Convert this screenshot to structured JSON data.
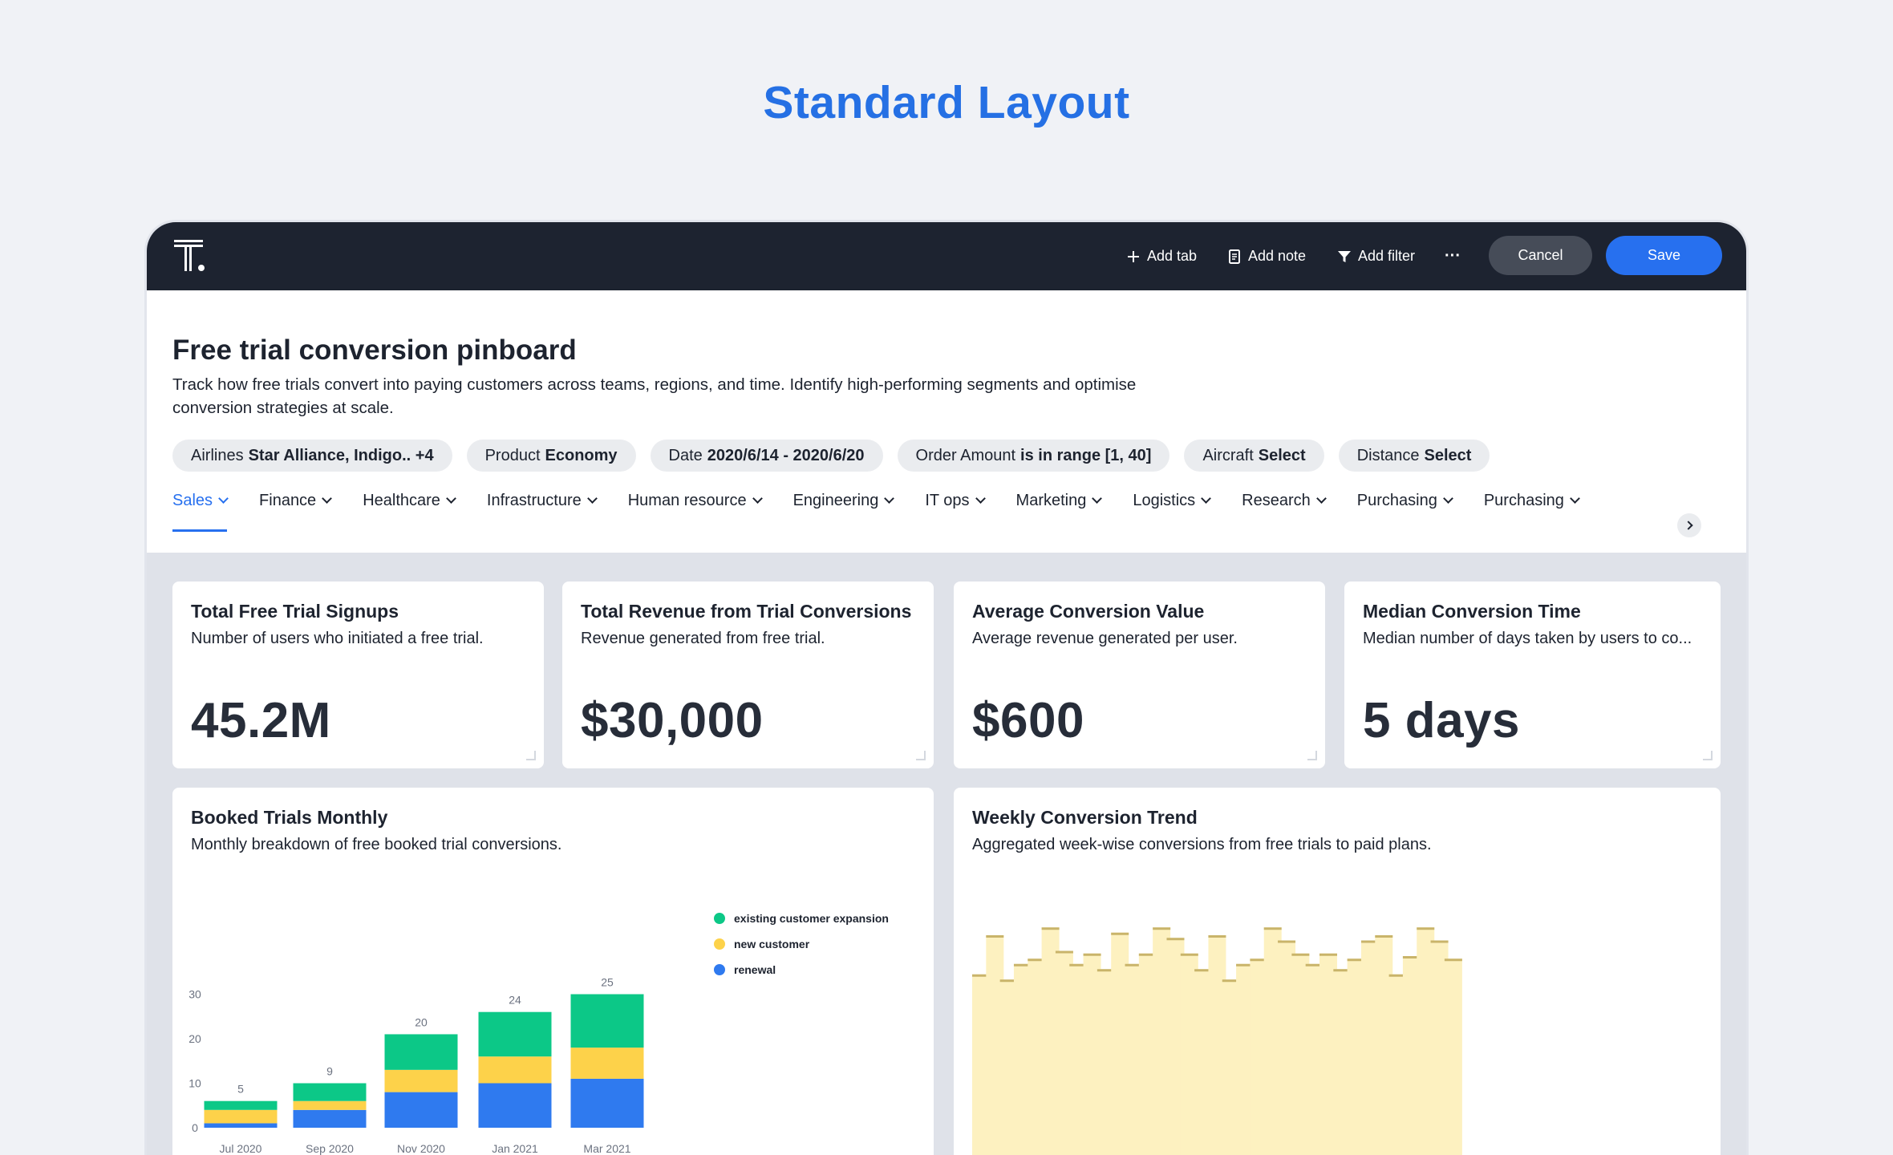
{
  "page_heading": "Standard Layout",
  "topbar": {
    "logo": "thoughtspot-logo",
    "add_tab": "Add tab",
    "add_note": "Add note",
    "add_filter": "Add filter",
    "more": "···",
    "cancel": "Cancel",
    "save": "Save"
  },
  "pinboard": {
    "title": "Free trial conversion pinboard",
    "description": "Track how free trials convert into paying customers across teams, regions, and time. Identify high-performing segments and optimise conversion strategies at scale."
  },
  "filters": [
    {
      "key": "Airlines",
      "value": "Star Alliance, Indigo.. +4"
    },
    {
      "key": "Product",
      "value": "Economy"
    },
    {
      "key": "Date",
      "value": "2020/6/14 - 2020/6/20"
    },
    {
      "key": "Order Amount",
      "value": "is in range [1, 40]"
    },
    {
      "key": "Aircraft",
      "value": "Select"
    },
    {
      "key": "Distance",
      "value": "Select"
    }
  ],
  "tabs": [
    "Sales",
    "Finance",
    "Healthcare",
    "Infrastructure",
    "Human resource",
    "Engineering",
    "IT ops",
    "Marketing",
    "Logistics",
    "Research",
    "Purchasing",
    "Purchasing"
  ],
  "active_tab": "Sales",
  "kpis": [
    {
      "title": "Total Free Trial Signups",
      "subtitle": "Number of users who initiated a free trial.",
      "value": "45.2M"
    },
    {
      "title": "Total Revenue from Trial Conversions",
      "subtitle": "Revenue generated from free trial.",
      "value": "$30,000"
    },
    {
      "title": "Average Conversion Value",
      "subtitle": "Average revenue generated per user.",
      "value": "$600"
    },
    {
      "title": "Median Conversion Time",
      "subtitle": "Median number of days taken by users to co...",
      "value": "5 days"
    }
  ],
  "booked_card": {
    "title": "Booked Trials Monthly",
    "subtitle": "Monthly breakdown of free booked trial conversions."
  },
  "weekly_card": {
    "title": "Weekly Conversion Trend",
    "subtitle": "Aggregated week-wise conversions from free trials to paid plans."
  },
  "colors": {
    "accent": "#2770ef",
    "topbar": "#1d2330",
    "existing": "#0cc887",
    "new": "#fdd24a",
    "renewal": "#2f7aef",
    "weekly_bar": "#fdf1c0",
    "weekly_cap": "#c9b46a"
  },
  "chart_data": [
    {
      "type": "bar",
      "stacked": true,
      "categories": [
        "Jul 2020",
        "Sep 2020",
        "Nov 2020",
        "Jan 2021",
        "Mar 2021"
      ],
      "series": [
        {
          "name": "renewal",
          "color": "#2f7aef",
          "values": [
            1,
            4,
            8,
            10,
            11
          ]
        },
        {
          "name": "new customer",
          "color": "#fdd24a",
          "values": [
            3,
            2,
            5,
            6,
            7
          ]
        },
        {
          "name": "existing customer expansion",
          "color": "#0cc887",
          "values": [
            2,
            4,
            8,
            10,
            12
          ]
        }
      ],
      "totals": [
        5,
        9,
        20,
        24,
        25
      ],
      "yticks": [
        0,
        10,
        20,
        30
      ],
      "ylim": [
        0,
        30
      ],
      "legend": "top-right"
    },
    {
      "type": "bar",
      "values": [
        73,
        88,
        71,
        77,
        79,
        91,
        82,
        77,
        81,
        75,
        89,
        77,
        81,
        91,
        87,
        81,
        75,
        88,
        71,
        77,
        79,
        91,
        86,
        81,
        77,
        81,
        75,
        79,
        86,
        88,
        73,
        80,
        91,
        86,
        79
      ],
      "visible_range": [
        0,
        100
      ]
    }
  ]
}
